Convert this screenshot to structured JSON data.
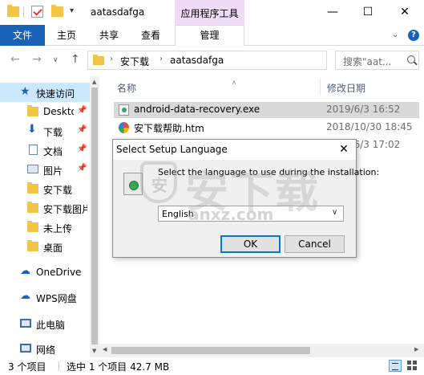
{
  "window": {
    "title": "aatasdafga",
    "tool_tab": "应用程序工具"
  },
  "ribbon": {
    "file": "文件",
    "home": "主页",
    "share": "共享",
    "view": "查看",
    "manage": "管理"
  },
  "address": {
    "crumbs": [
      "安下载",
      "aatasdafga"
    ],
    "search_placeholder": "搜索\"aat..."
  },
  "nav": {
    "quick_access": "快速访问",
    "items": [
      "Desktop",
      "下载",
      "文档",
      "图片",
      "安下载",
      "安下载图片",
      "未上传",
      "桌面"
    ],
    "onedrive": "OneDrive",
    "wps": "WPS网盘",
    "this_pc": "此电脑",
    "network": "网络"
  },
  "list": {
    "col_name": "名称",
    "col_modified": "修改日期",
    "files": [
      {
        "name": "android-data-recovery.exe",
        "date": "2019/6/3 16:52"
      },
      {
        "name": "安下载帮助.htm",
        "date": "2018/10/30 18:45"
      },
      {
        "name": "",
        "date": "2019/6/3 17:02"
      }
    ]
  },
  "status": {
    "count": "3 个项目",
    "selected": "选中 1 个项目  42.7 MB"
  },
  "dialog": {
    "title": "Select Setup Language",
    "message": "Select the language to use during the installation:",
    "language": "English",
    "ok": "OK",
    "cancel": "Cancel"
  },
  "watermark": {
    "logo_char": "安",
    "big_text": "安下载",
    "url": "anxz.com"
  },
  "colors": {
    "accent": "#1a62b8",
    "tool_tab_bg": "#f0dcf7",
    "nav_selected": "#cce8ff",
    "row_selected": "#d9d9d9",
    "folder": "#f3c545"
  }
}
